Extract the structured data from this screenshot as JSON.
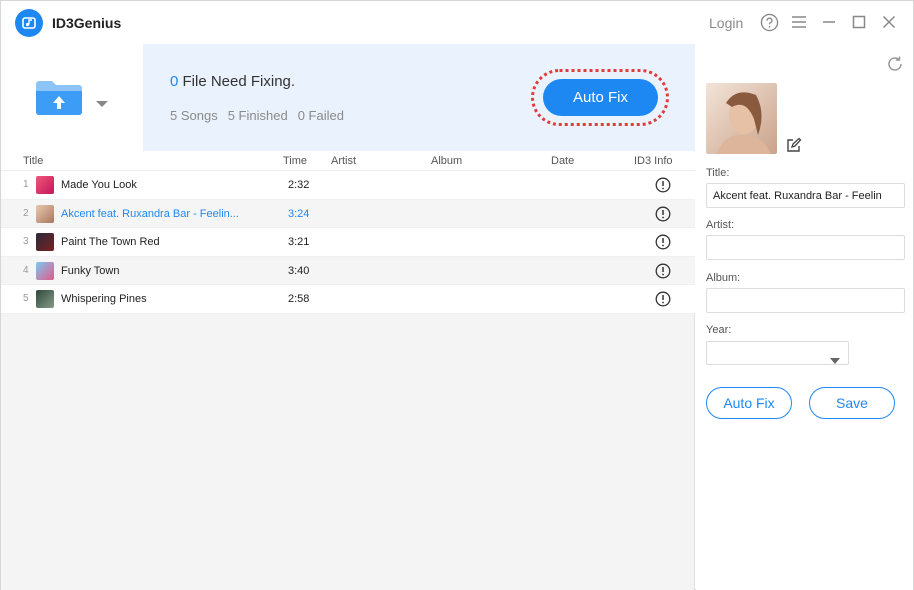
{
  "app": {
    "title": "ID3Genius",
    "login_label": "Login"
  },
  "colors": {
    "accent": "#1e88f2",
    "highlight_ring": "#e23b3b",
    "banner_bg": "#eaf3fd"
  },
  "titlebar_icons": [
    "help-icon",
    "menu-icon",
    "minimize-icon",
    "maximize-icon",
    "close-icon"
  ],
  "banner": {
    "need_fix_count": "0",
    "need_fix_text": " File Need Fixing.",
    "songs": "5 Songs",
    "finished": "5 Finished",
    "failed": "0 Failed",
    "auto_fix_label": "Auto Fix"
  },
  "table": {
    "columns": [
      "Title",
      "Time",
      "Artist",
      "Album",
      "Date",
      "ID3 Info"
    ],
    "rows": [
      {
        "num": "1",
        "title": "Made You Look",
        "time": "2:32"
      },
      {
        "num": "2",
        "title": "Akcent feat. Ruxandra Bar - Feelin...",
        "time": "3:24"
      },
      {
        "num": "3",
        "title": "Paint The Town Red",
        "time": "3:21"
      },
      {
        "num": "4",
        "title": "Funky Town",
        "time": "3:40"
      },
      {
        "num": "5",
        "title": "Whispering Pines",
        "time": "2:58"
      }
    ]
  },
  "panel": {
    "title_label": "Title:",
    "title_value": "Akcent feat. Ruxandra Bar - Feelin",
    "artist_label": "Artist:",
    "artist_value": "",
    "album_label": "Album:",
    "album_value": "",
    "year_label": "Year:",
    "auto_fix_label": "Auto Fix",
    "save_label": "Save"
  }
}
